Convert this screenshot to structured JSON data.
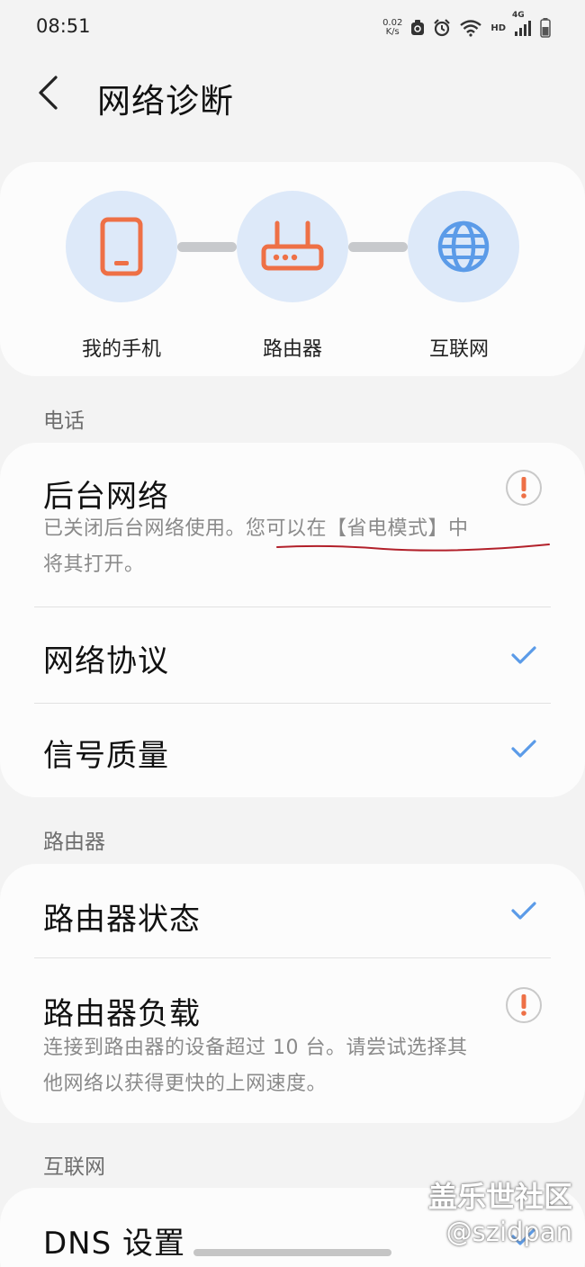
{
  "status_bar": {
    "time": "08:51",
    "net_speed_value": "0.02",
    "net_speed_unit": "K/s",
    "hd": "HD",
    "signal_type": "4G"
  },
  "header": {
    "title": "网络诊断"
  },
  "diagram": {
    "nodes": [
      {
        "label": "我的手机",
        "icon": "phone-icon"
      },
      {
        "label": "路由器",
        "icon": "router-icon"
      },
      {
        "label": "互联网",
        "icon": "globe-icon"
      }
    ]
  },
  "sections": {
    "phone": {
      "header": "电话",
      "items": [
        {
          "title": "后台网络",
          "status": "warning",
          "desc_line1": "已关闭后台网络使用。您可以在【省电模式】中",
          "desc_line2": "将其打开。"
        },
        {
          "title": "网络协议",
          "status": "ok"
        },
        {
          "title": "信号质量",
          "status": "ok"
        }
      ]
    },
    "router": {
      "header": "路由器",
      "items": [
        {
          "title": "路由器状态",
          "status": "ok"
        },
        {
          "title": "路由器负载",
          "status": "warning",
          "desc_line1": "连接到路由器的设备超过 10 台。请尝试选择其",
          "desc_line2": "他网络以获得更快的上网速度。"
        }
      ]
    },
    "internet": {
      "header": "互联网",
      "items": [
        {
          "title": "DNS 设置",
          "status": "ok"
        }
      ]
    }
  },
  "watermark": {
    "line1": "盖乐世社区",
    "line2": "@szidpan"
  },
  "colors": {
    "accent_blue": "#5b9be8",
    "warning_orange": "#ee7046",
    "node_bg": "#dde9f9",
    "annotation_red": "#b2202a"
  }
}
